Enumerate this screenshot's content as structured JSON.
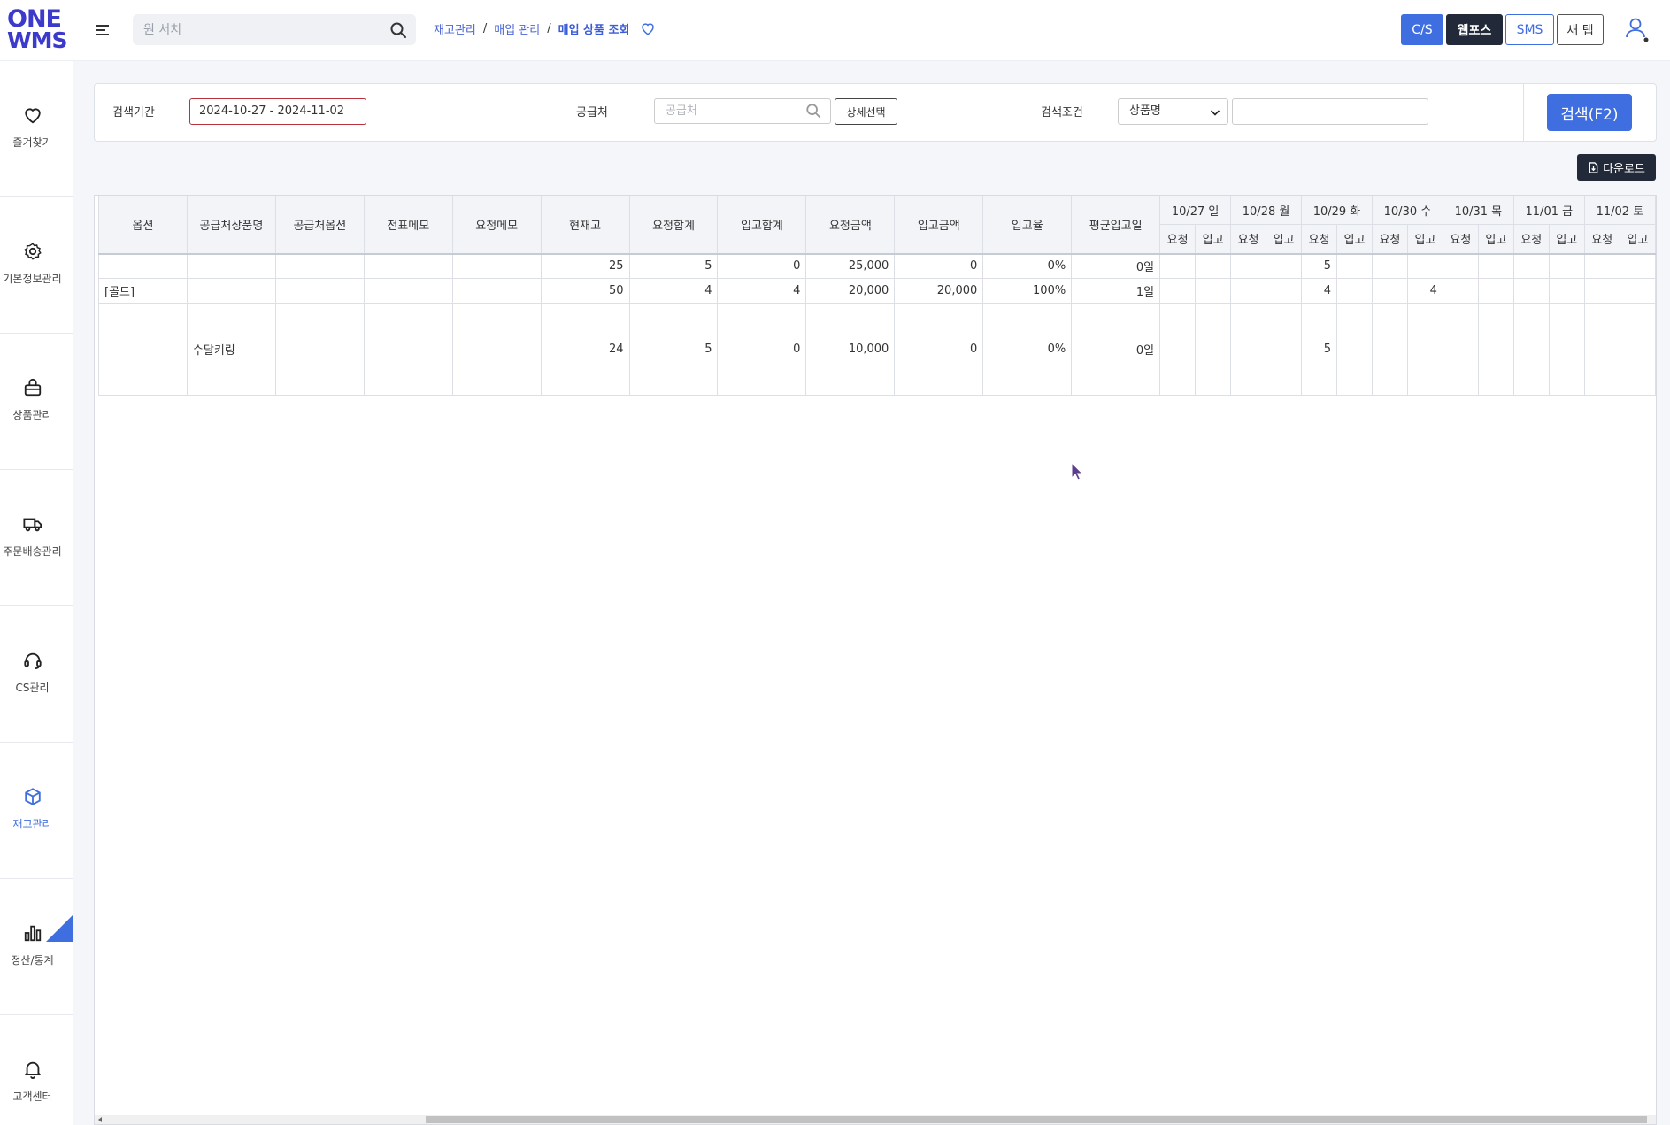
{
  "app": {
    "logo_line1": "ONE",
    "logo_line2": "WMS"
  },
  "header": {
    "search_placeholder": "원 서치",
    "breadcrumb": [
      "재고관리",
      "매입 관리",
      "매입 상품 조회"
    ],
    "buttons": {
      "cs": "C/S",
      "webpos": "웹포스",
      "sms": "SMS",
      "newtab": "새 탭"
    }
  },
  "sidebar": {
    "items": [
      {
        "label": "즐겨찾기",
        "icon": "heart-icon"
      },
      {
        "label": "기본정보관리",
        "icon": "gear-icon"
      },
      {
        "label": "상품관리",
        "icon": "bag-icon"
      },
      {
        "label": "주문배송관리",
        "icon": "truck-icon"
      },
      {
        "label": "CS관리",
        "icon": "headset-icon"
      },
      {
        "label": "재고관리",
        "icon": "box-icon",
        "active": true
      },
      {
        "label": "정산/통계",
        "icon": "bar-chart-icon"
      },
      {
        "label": "고객센터",
        "icon": "bell-icon"
      }
    ]
  },
  "filter": {
    "period_label": "검색기간",
    "period_value": "2024-10-27 - 2024-11-02",
    "supplier_label": "공급처",
    "supplier_placeholder": "공급처",
    "detail_button": "상세선택",
    "condition_label": "검색조건",
    "condition_value": "상품명",
    "search_button": "검색(F2)"
  },
  "download_button": "다운로드",
  "table": {
    "columns": [
      "옵션",
      "공급처상품명",
      "공급처옵션",
      "전표메모",
      "요청메모",
      "현재고",
      "요청합계",
      "입고합계",
      "요청금액",
      "입고금액",
      "입고율",
      "평균입고일"
    ],
    "dates": [
      "10/27 일",
      "10/28 월",
      "10/29 화",
      "10/30 수",
      "10/31 목",
      "11/01 금",
      "11/02 토"
    ],
    "sub_columns": [
      "요청",
      "입고"
    ],
    "rows": [
      {
        "cells": [
          "",
          "",
          "",
          "",
          "",
          "25",
          "5",
          "0",
          "25,000",
          "0",
          "0%",
          "0일"
        ],
        "daily": [
          "",
          "",
          "",
          "",
          "5",
          "",
          "",
          "",
          "",
          "",
          "",
          "",
          "",
          ""
        ]
      },
      {
        "cells": [
          "[골드]",
          "",
          "",
          "",
          "",
          "50",
          "4",
          "4",
          "20,000",
          "20,000",
          "100%",
          "1일"
        ],
        "daily": [
          "",
          "",
          "",
          "",
          "4",
          "",
          "",
          "4",
          "",
          "",
          "",
          "",
          "",
          ""
        ]
      },
      {
        "cells": [
          "",
          "수달키링",
          "",
          "",
          "",
          "24",
          "5",
          "0",
          "10,000",
          "0",
          "0%",
          "0일"
        ],
        "daily": [
          "",
          "",
          "",
          "",
          "5",
          "",
          "",
          "",
          "",
          "",
          "",
          "",
          "",
          ""
        ]
      }
    ]
  },
  "colors": {
    "accent": "#3f6ee0",
    "brand": "#3c3acb",
    "dark_button": "#222a3a",
    "date_border": "#b9313d"
  }
}
